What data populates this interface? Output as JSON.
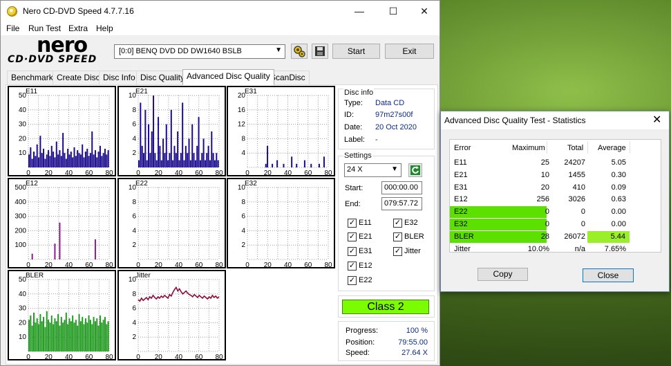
{
  "app": {
    "title": "Nero CD-DVD Speed 4.7.7.16",
    "window_controls": {
      "minimize": "—",
      "maximize": "☐",
      "close": "✕"
    },
    "menu": [
      "File",
      "Run Test",
      "Extra",
      "Help"
    ],
    "logo": {
      "top": "nero",
      "bottom": "CD·DVD SPEED"
    },
    "drive": "[0:0]   BENQ DVD DD DW1640 BSLB",
    "buttons": {
      "start": "Start",
      "exit": "Exit"
    }
  },
  "tabs": [
    "Benchmark",
    "Create Disc",
    "Disc Info",
    "Disc Quality",
    "Advanced Disc Quality",
    "ScanDisc"
  ],
  "active_tab": "Advanced Disc Quality",
  "chart_data": [
    {
      "name": "E11",
      "type": "bar",
      "ymax": 50,
      "yticks": [
        "50",
        "40",
        "30",
        "20",
        "10"
      ],
      "xticks": [
        "0",
        "20",
        "40",
        "60",
        "80"
      ],
      "color": "#1a0a8c",
      "values": [
        9,
        14,
        6,
        11,
        8,
        16,
        7,
        22,
        10,
        13,
        6,
        9,
        12,
        8,
        15,
        11,
        7,
        18,
        9,
        12,
        8,
        24,
        10,
        6,
        13,
        9,
        11,
        7,
        14,
        8,
        12,
        10,
        9,
        16,
        7,
        11,
        13,
        8,
        10,
        25,
        9,
        12,
        7,
        11,
        15,
        8,
        10,
        13,
        9,
        12
      ]
    },
    {
      "name": "E21",
      "type": "bar",
      "ymax": 10,
      "yticks": [
        "10",
        "8",
        "6",
        "4",
        "2"
      ],
      "xticks": [
        "0",
        "20",
        "40",
        "60",
        "80"
      ],
      "color": "#1a0a8c",
      "values": [
        1,
        9,
        3,
        2,
        8,
        1,
        6,
        2,
        5,
        10,
        2,
        1,
        7,
        3,
        1,
        4,
        2,
        6,
        1,
        2,
        8,
        1,
        3,
        2,
        5,
        1,
        2,
        9,
        1,
        3,
        2,
        4,
        1,
        6,
        2,
        1,
        3,
        7,
        1,
        2,
        4,
        1,
        2,
        3,
        1,
        5,
        2,
        1,
        2,
        1
      ]
    },
    {
      "name": "E31",
      "type": "bar",
      "ymax": 20,
      "yticks": [
        "20",
        "16",
        "12",
        "8",
        "4"
      ],
      "xticks": [
        "0",
        "20",
        "40",
        "60",
        "80"
      ],
      "color": "#1a0a8c",
      "values": [
        0,
        0,
        0,
        0,
        0,
        0,
        0,
        0,
        0,
        0,
        0,
        1,
        6,
        0,
        0,
        1,
        0,
        0,
        2,
        0,
        0,
        0,
        1,
        0,
        0,
        0,
        0,
        3,
        0,
        0,
        1,
        0,
        0,
        0,
        0,
        2,
        0,
        0,
        0,
        1,
        0,
        0,
        0,
        0,
        1,
        0,
        0,
        3,
        0,
        0
      ]
    },
    {
      "name": "E12",
      "type": "bar",
      "ymax": 500,
      "yticks": [
        "500",
        "400",
        "300",
        "200",
        "100"
      ],
      "xticks": [
        "0",
        "20",
        "40",
        "60",
        "80"
      ],
      "color": "#8b1a8b",
      "values": [
        0,
        0,
        40,
        0,
        0,
        0,
        0,
        0,
        0,
        0,
        0,
        0,
        0,
        0,
        0,
        0,
        110,
        0,
        0,
        256,
        0,
        0,
        0,
        0,
        0,
        0,
        0,
        0,
        0,
        0,
        0,
        0,
        0,
        0,
        0,
        0,
        0,
        0,
        0,
        0,
        0,
        140,
        0,
        0,
        0,
        0,
        0,
        0,
        0,
        0
      ]
    },
    {
      "name": "E22",
      "type": "bar",
      "ymax": 10,
      "yticks": [
        "10",
        "8",
        "6",
        "4",
        "2"
      ],
      "xticks": [
        "0",
        "20",
        "40",
        "60",
        "80"
      ],
      "color": "#1a0a8c",
      "values": []
    },
    {
      "name": "E32",
      "type": "bar",
      "ymax": 10,
      "yticks": [
        "10",
        "8",
        "6",
        "4",
        "2"
      ],
      "xticks": [
        "0",
        "20",
        "40",
        "60",
        "80"
      ],
      "color": "#1a0a8c",
      "values": []
    },
    {
      "name": "BLER",
      "type": "bar",
      "ymax": 50,
      "yticks": [
        "50",
        "40",
        "30",
        "20",
        "10"
      ],
      "xticks": [
        "0",
        "20",
        "40",
        "60",
        "80"
      ],
      "color": "#1f9a1f",
      "values": [
        22,
        25,
        18,
        27,
        20,
        23,
        19,
        26,
        21,
        24,
        17,
        28,
        22,
        20,
        25,
        19,
        23,
        21,
        26,
        18,
        24,
        20,
        22,
        27,
        19,
        23,
        21,
        25,
        20,
        22,
        18,
        26,
        21,
        24,
        19,
        23,
        20,
        25,
        22,
        19,
        24,
        21,
        23,
        18,
        25,
        20,
        22,
        24,
        19,
        21
      ]
    },
    {
      "name": "Jitter",
      "type": "line",
      "ymax": 10,
      "yticks": [
        "10",
        "8",
        "6",
        "4",
        "2"
      ],
      "xticks": [
        "0",
        "20",
        "40",
        "60",
        "80"
      ],
      "color": "#8b0a3a",
      "values": [
        7.2,
        7.0,
        7.4,
        7.1,
        7.3,
        7.5,
        7.2,
        7.6,
        7.4,
        7.8,
        7.5,
        7.3,
        7.6,
        7.4,
        7.7,
        7.5,
        7.8,
        7.6,
        7.4,
        7.9,
        7.7,
        8.2,
        8.6,
        8.9,
        8.4,
        8.7,
        8.3,
        8.0,
        8.2,
        8.4,
        8.1,
        7.9,
        7.8,
        7.6,
        7.9,
        7.7,
        7.5,
        7.8,
        7.6,
        7.4,
        7.7,
        7.5,
        7.3,
        7.6,
        7.4,
        7.8,
        7.5,
        7.7,
        7.4,
        7.6
      ]
    }
  ],
  "disc_info": {
    "label": "Disc info",
    "rows": [
      {
        "key": "Type:",
        "value": "Data CD"
      },
      {
        "key": "ID:",
        "value": "97m27s00f"
      },
      {
        "key": "Date:",
        "value": "20 Oct 2020"
      },
      {
        "key": "Label:",
        "value": "-"
      }
    ]
  },
  "settings": {
    "label": "Settings",
    "speed": "24 X",
    "start_label": "Start:",
    "start_value": "000:00.00",
    "end_label": "End:",
    "end_value": "079:57.72",
    "checks_left": [
      "E11",
      "E21",
      "E31",
      "E12",
      "E22"
    ],
    "checks_right": [
      "E32",
      "BLER",
      "Jitter"
    ],
    "check_mark": "✓"
  },
  "class": "Class 2",
  "progress": {
    "progress_label": "Progress:",
    "progress_value": "100 %",
    "position_label": "Position:",
    "position_value": "79:55.00",
    "speed_label": "Speed:",
    "speed_value": "27.64 X"
  },
  "stats": {
    "title": "Advanced Disc Quality Test - Statistics",
    "headers": [
      "Error",
      "Maximum",
      "Total",
      "Average"
    ],
    "rows": [
      [
        "E11",
        "25",
        "24207",
        "5.05"
      ],
      [
        "E21",
        "10",
        "1455",
        "0.30"
      ],
      [
        "E31",
        "20",
        "410",
        "0.09"
      ],
      [
        "E12",
        "256",
        "3026",
        "0.63"
      ],
      [
        "E22",
        "0",
        "0",
        "0.00"
      ],
      [
        "E32",
        "0",
        "0",
        "0.00"
      ],
      [
        "BLER",
        "28",
        "26072",
        "5.44"
      ],
      [
        "Jitter",
        "10.0%",
        "n/a",
        "7.65%"
      ]
    ],
    "highlight_color": "#5ce000",
    "highlight_color2": "#9bee2a",
    "copy": "Copy",
    "close": "Close",
    "close_x": "✕"
  }
}
